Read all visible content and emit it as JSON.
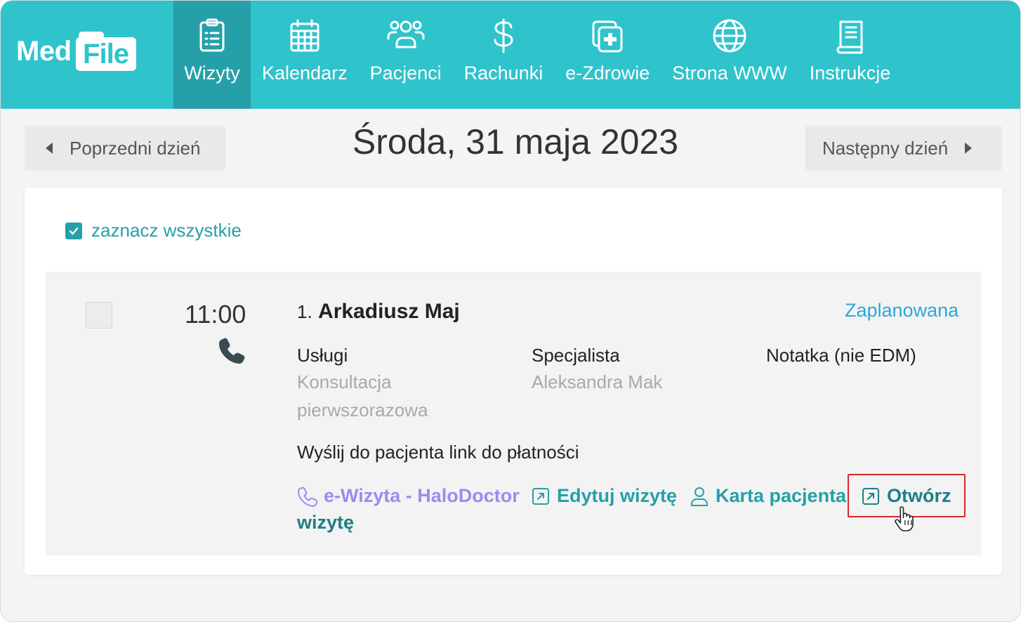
{
  "app": {
    "logo_med": "Med",
    "logo_file": "File"
  },
  "nav": {
    "items": [
      {
        "label": "Wizyty",
        "icon": "clipboard-list-icon",
        "active": true
      },
      {
        "label": "Kalendarz",
        "icon": "calendar-icon"
      },
      {
        "label": "Pacjenci",
        "icon": "users-icon"
      },
      {
        "label": "Rachunki",
        "icon": "dollar-icon"
      },
      {
        "label": "e-Zdrowie",
        "icon": "medical-cross-icon"
      },
      {
        "label": "Strona WWW",
        "icon": "globe-icon"
      },
      {
        "label": "Instrukcje",
        "icon": "book-icon"
      }
    ]
  },
  "day_nav": {
    "prev_label": "Poprzedni dzień",
    "next_label": "Następny dzień",
    "title": "Środa, 31 maja 2023"
  },
  "list": {
    "select_all_label": "zaznacz wszystkie",
    "visit": {
      "time": "11:00",
      "number": "1.",
      "patient_name": "Arkadiusz Maj",
      "status": "Zaplanowana",
      "services_label": "Usługi",
      "services_value_line1": "Konsultacja",
      "services_value_line2": "pierwszorazowa",
      "specialist_label": "Specjalista",
      "specialist_value": "Aleksandra Mak",
      "note_label": "Notatka (nie EDM)",
      "payment_link": "Wyślij do pacjenta link do płatności",
      "actions": {
        "halo": "e-Wizyta - HaloDoctor",
        "halo_continuation": "wizytę",
        "edit": "Edytuj wizytę",
        "patient_card": "Karta pacjenta",
        "open": "Otwórz"
      }
    }
  },
  "colors": {
    "header": "#2fc3cc",
    "header_active": "#25a0a8",
    "link": "#25a0a8",
    "status": "#2aa8d8",
    "halo": "#9a8cf0",
    "highlight": "#d9262b"
  }
}
